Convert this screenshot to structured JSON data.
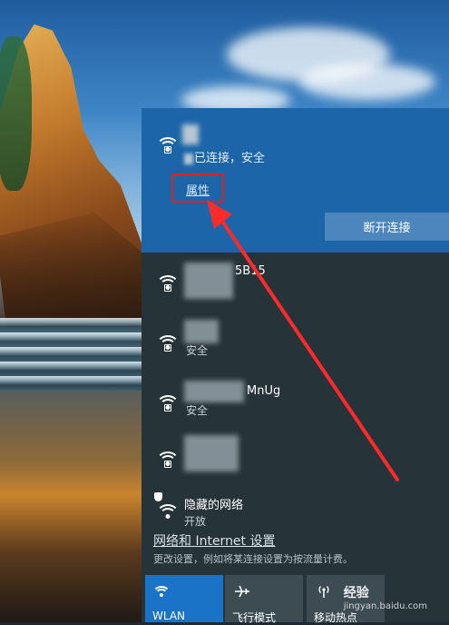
{
  "connected_network": {
    "status": "已连接，安全",
    "properties_link": "属性",
    "disconnect_button": "断开连接"
  },
  "networks": [
    {
      "name": "5B15"
    },
    {
      "name": "",
      "sub": "安全"
    },
    {
      "name": "MnUg",
      "sub": "安全"
    },
    {
      "name": ""
    }
  ],
  "hidden_network": {
    "name": "隐藏的网络",
    "sub": "开放"
  },
  "settings": {
    "link": "网络和 Internet 设置",
    "description": "更改设置，例如将某连接设置为按流量计费。"
  },
  "quick_actions": [
    {
      "label": "WLAN",
      "icon": "wifi-icon"
    },
    {
      "label": "飞行模式",
      "icon": "airplane-icon"
    },
    {
      "label": "移动热点",
      "icon": "hotspot-icon"
    }
  ],
  "watermark": {
    "brand": "经验",
    "url": "jingyan.baidu.com"
  },
  "colors": {
    "accent": "#1c65a8",
    "panel": "#263339",
    "highlight": "#e02020"
  }
}
